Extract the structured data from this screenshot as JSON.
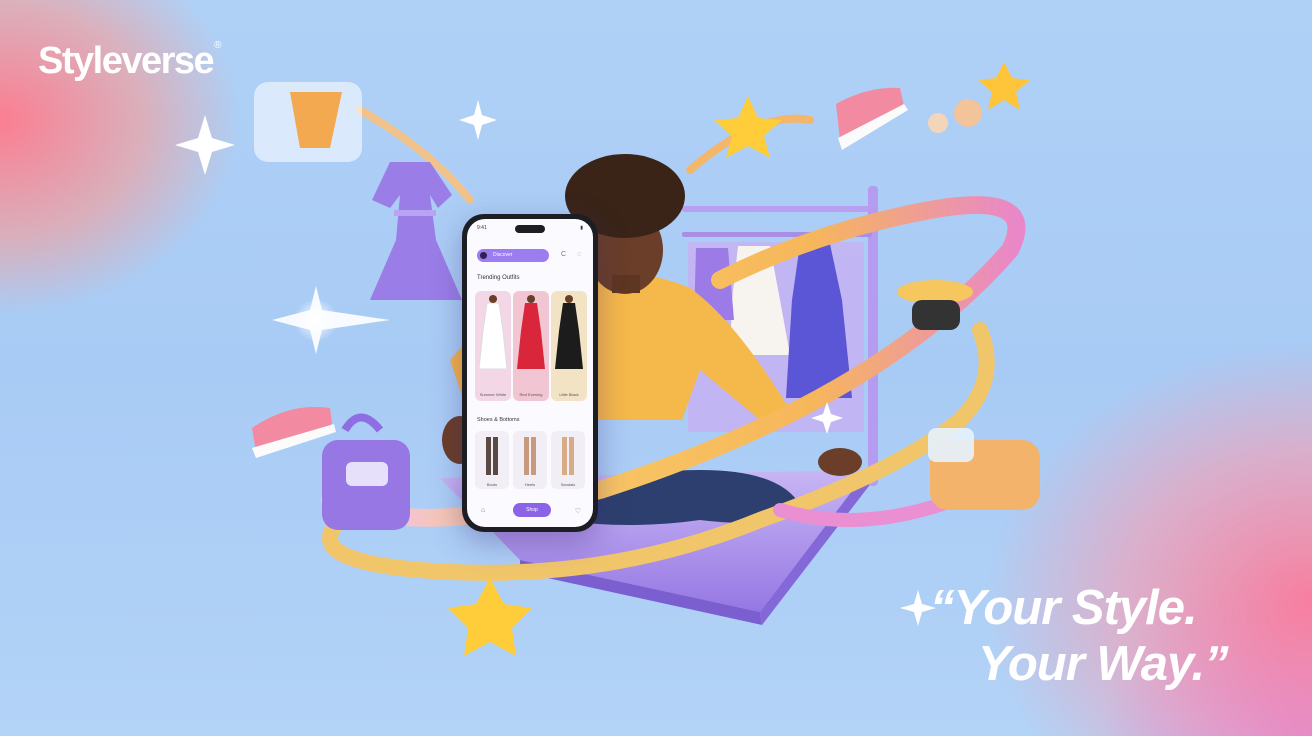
{
  "brand": {
    "name": "Styleverse",
    "mark": "®"
  },
  "tagline": {
    "line1": "“Your Style.",
    "line2": "Your Way.”"
  },
  "app": {
    "status_time": "9:41",
    "search_label": "Discover",
    "section1": "Trending Outfits",
    "outfits": [
      {
        "caption": "Summer White",
        "color": "#f3d7e6",
        "dress": "#ffffff"
      },
      {
        "caption": "Red Evening",
        "color": "#f1c6d2",
        "dress": "#d9263a"
      },
      {
        "caption": "Little Black",
        "color": "#f3e3c5",
        "dress": "#1c1c1c"
      }
    ],
    "section2": "Shoes & Bottoms",
    "bottoms": [
      {
        "caption": "Boots",
        "color": "#5b4a43"
      },
      {
        "caption": "Heels",
        "color": "#c79a7d"
      },
      {
        "caption": "Sandals",
        "color": "#d8ab87"
      }
    ],
    "cta": "Shop"
  },
  "colors": {
    "accent": "#8a63e6",
    "ribbon": "#f7c45a",
    "platform": "#a88ee8",
    "sweater": "#f5b84a",
    "star": "#ffcc3a"
  }
}
